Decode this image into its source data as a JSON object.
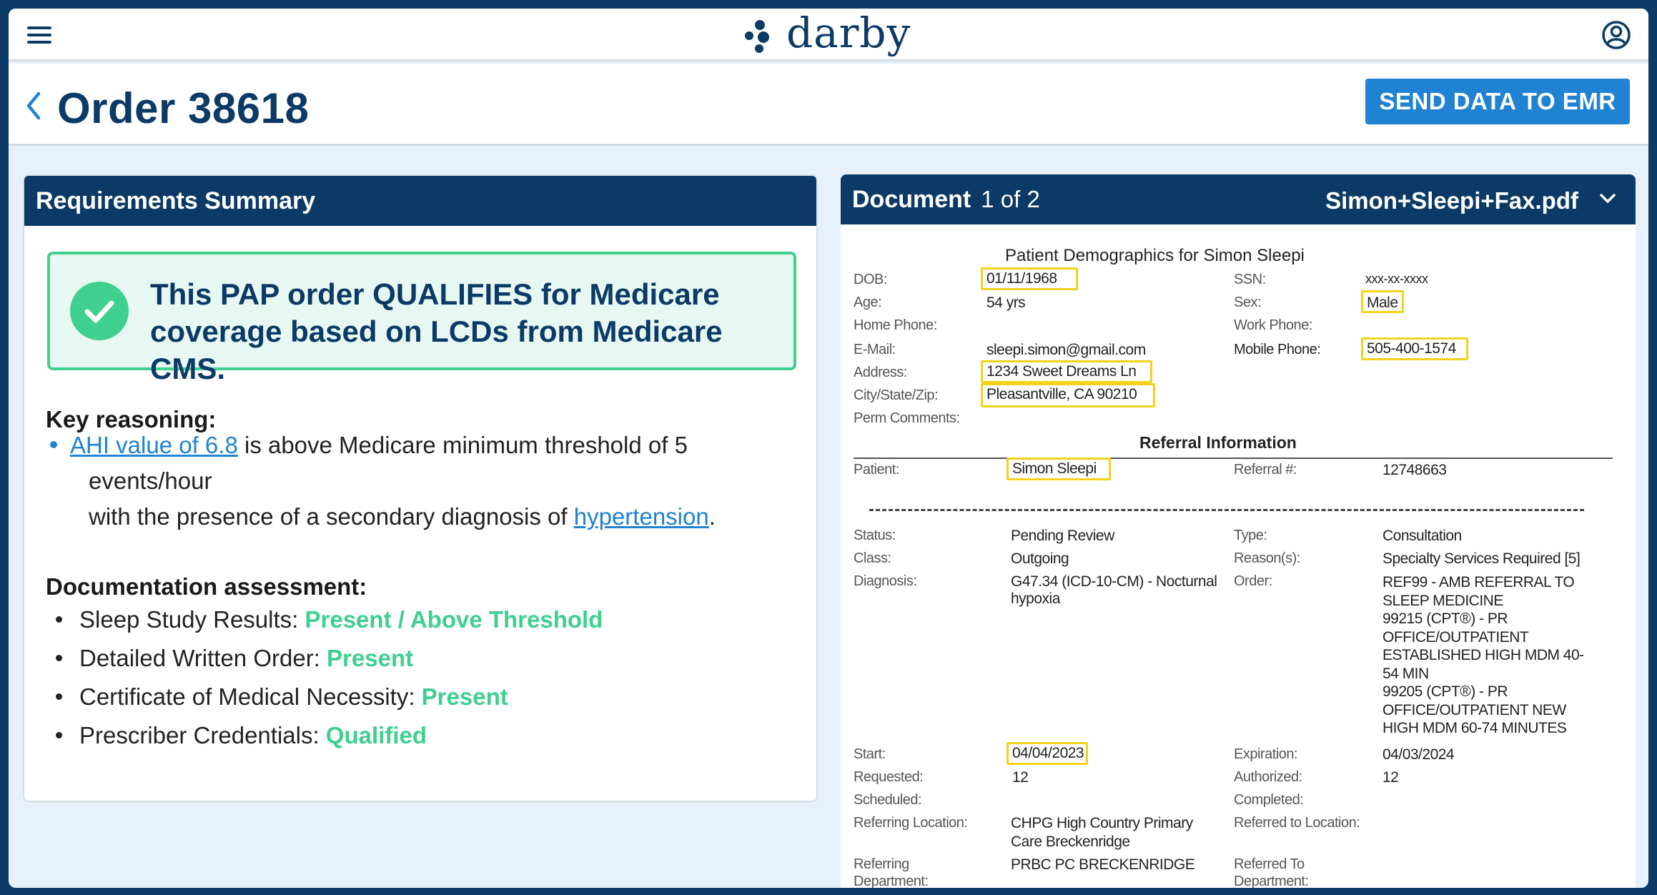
{
  "app": {
    "logo_text": "darby",
    "menu_icon": "menu-icon",
    "account_icon": "account-icon"
  },
  "header": {
    "title": "Order 38618",
    "send_button": "SEND DATA TO EMR"
  },
  "requirements": {
    "title": "Requirements Summary",
    "qualify_line1": "This PAP order QUALIFIES for Medicare",
    "qualify_line2": "coverage based on LCDs from Medicare CMS.",
    "key_reasoning_title": "Key reasoning:",
    "reason_link": "AHI value of 6.8",
    "reason_text1": " is above Medicare minimum threshold of 5",
    "reason_text2": "events/hour",
    "reason_text3": "with the presence of a secondary diagnosis of ",
    "reason_link2": "hypertension",
    "reason_end": ".",
    "doc_assessment_title": "Documentation assessment:",
    "docs": [
      {
        "label": "Sleep Study Results: ",
        "status": "Present / Above Threshold"
      },
      {
        "label": "Detailed Written Order: ",
        "status": "Present"
      },
      {
        "label": "Certificate of Medical Necessity: ",
        "status": "Present"
      },
      {
        "label": "Prescriber Credentials: ",
        "status": "Qualified"
      }
    ]
  },
  "document": {
    "title": "Document",
    "page_indicator": "1 of 2",
    "filename": "Simon+Sleepi+Fax.pdf",
    "demographics_title": "Patient Demographics for Simon Sleepi",
    "dob_label": "DOB:",
    "dob": "01/11/1968",
    "ssn_label": "SSN:",
    "ssn": "xxx-xx-xxxx",
    "age_label": "Age:",
    "age": "54 yrs",
    "sex_label": "Sex:",
    "sex": "Male",
    "home_phone_label": "Home Phone:",
    "work_phone_label": "Work Phone:",
    "email_label": "E-Mail:",
    "email": "sleepi.simon@gmail.com",
    "mobile_label": "Mobile Phone:",
    "mobile": "505-400-1574",
    "address_label": "Address:",
    "address": "1234 Sweet Dreams Ln",
    "city_label": "City/State/Zip:",
    "city": "Pleasantville, CA 90210",
    "perm_label": "Perm Comments:",
    "referral_title": "Referral Information",
    "patient_label": "Patient:",
    "patient": "Simon Sleepi",
    "referral_no_label": "Referral #:",
    "referral_no": "12748663",
    "status_label": "Status:",
    "status": "Pending Review",
    "type_label": "Type:",
    "type": "Consultation",
    "class_label": "Class:",
    "class": "Outgoing",
    "reasons_label": "Reason(s):",
    "reasons": "Specialty Services Required [5]",
    "diagnosis_label": "Diagnosis:",
    "diagnosis1": "G47.34 (ICD-10-CM) - Nocturnal",
    "diagnosis2": "hypoxia",
    "order_label": "Order:",
    "order_lines": [
      "REF99 - AMB REFERRAL TO",
      "SLEEP MEDICINE",
      "99215 (CPT®) - PR",
      "OFFICE/OUTPATIENT",
      "ESTABLISHED HIGH MDM 40-",
      "54 MIN",
      "99205 (CPT®) - PR",
      "OFFICE/OUTPATIENT NEW",
      "HIGH MDM 60-74 MINUTES"
    ],
    "start_label": "Start:",
    "start": "04/04/2023",
    "expiration_label": "Expiration:",
    "expiration": "04/03/2024",
    "requested_label": "Requested:",
    "requested": "12",
    "authorized_label": "Authorized:",
    "authorized": "12",
    "scheduled_label": "Scheduled:",
    "completed_label": "Completed:",
    "ref_loc_label": "Referring Location:",
    "ref_loc1": "CHPG High Country Primary",
    "ref_loc2": "Care Breckenridge",
    "referred_to_loc_label": "Referred to Location:",
    "ref_dept_label1": "Referring",
    "ref_dept_label2": "Department:",
    "ref_dept": "PRBC PC BRECKENRIDGE",
    "referred_to_dept_label1": "Referred To",
    "referred_to_dept_label2": "Department:"
  },
  "colors": {
    "navy": "#0b3a66",
    "accent": "#1f82d2",
    "success": "#3fcf8e",
    "highlight": "#f2d21c"
  }
}
